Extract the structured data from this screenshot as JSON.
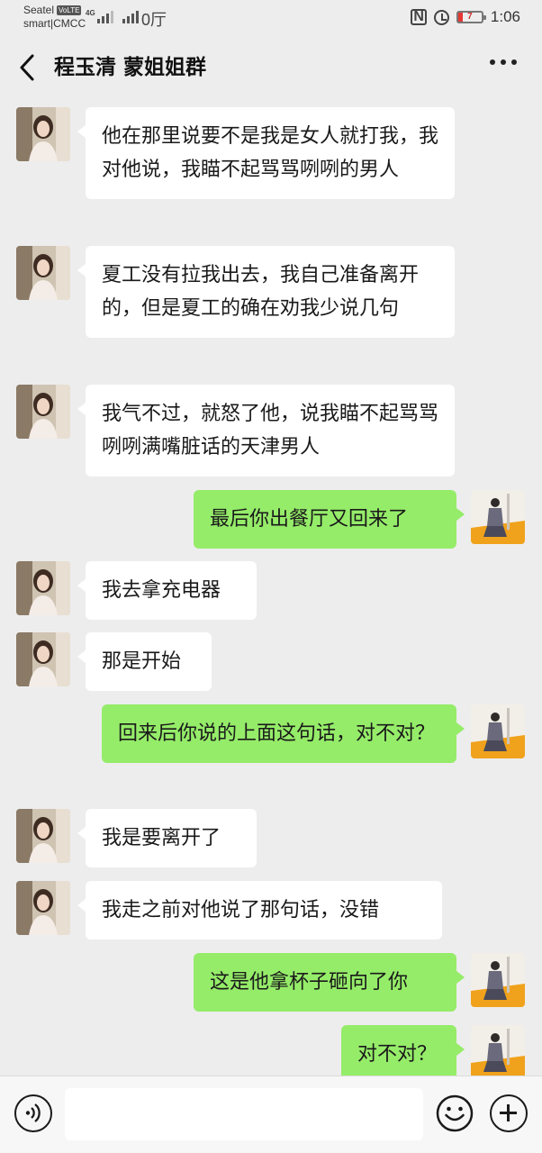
{
  "status_bar": {
    "carrier_top": "Seatel",
    "volte": "VoLTE",
    "carrier_bottom": "smart|CMCC",
    "network": "4G",
    "speed_glyph": "0厅",
    "battery": "7",
    "time": "1:06",
    "icons": [
      "nfc-icon",
      "alarm-icon",
      "battery-icon"
    ]
  },
  "header": {
    "title": "程玉清 蒙姐姐群",
    "back_icon": "chevron-left-icon",
    "more_icon": "more-icon"
  },
  "messages": [
    {
      "side": "in",
      "text": "他在那里说要不是我是女人就打我，我对他说，我瞄不起骂骂咧咧的男人"
    },
    {
      "side": "in",
      "text": "夏工没有拉我出去，我自己准备离开的，但是夏工的确在劝我少说几句"
    },
    {
      "side": "in",
      "text": "我气不过，就怒了他，说我瞄不起骂骂咧咧满嘴脏话的天津男人"
    },
    {
      "side": "out",
      "text": "最后你出餐厅又回来了"
    },
    {
      "side": "in",
      "text": "我去拿充电器"
    },
    {
      "side": "in",
      "text": "那是开始"
    },
    {
      "side": "out",
      "text": "回来后你说的上面这句话，对不对？"
    },
    {
      "side": "in",
      "text": "我是要离开了"
    },
    {
      "side": "in",
      "text": "我走之前对他说了那句话，没错"
    },
    {
      "side": "out",
      "text": "这是他拿杯子砸向了你"
    },
    {
      "side": "out",
      "text": "对不对？"
    }
  ],
  "input_bar": {
    "voice_icon": "voice-icon",
    "emoji_icon": "emoji-icon",
    "plus_icon": "plus-icon",
    "input_value": ""
  },
  "colors": {
    "background": "#ededed",
    "incoming_bubble": "#ffffff",
    "outgoing_bubble": "#95ec69"
  }
}
